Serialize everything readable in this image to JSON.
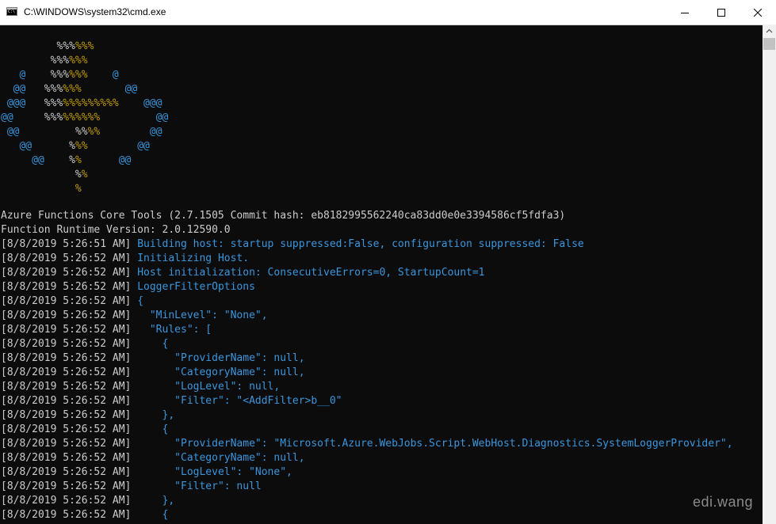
{
  "window": {
    "title": "C:\\WINDOWS\\system32\\cmd.exe",
    "icon": "cmd-icon",
    "buttons": [
      "minimize-icon",
      "maximize-icon",
      "close-icon"
    ]
  },
  "colors": {
    "background": "#0c0c0c",
    "text": "#cccccc",
    "cyan": "#3a96dd",
    "yellow": "#c19c00"
  },
  "logo": [
    [
      [
        "         ",
        "w"
      ],
      [
        "%%%",
        "wy"
      ],
      [
        "%%%",
        "y"
      ]
    ],
    [
      [
        "        ",
        "w"
      ],
      [
        "%%%",
        "wy"
      ],
      [
        "%%%",
        "y"
      ]
    ],
    [
      [
        "   ",
        "w"
      ],
      [
        "@",
        "c"
      ],
      [
        "    ",
        "w"
      ],
      [
        "%%%",
        "wy"
      ],
      [
        "%%%",
        "y"
      ],
      [
        "    ",
        "w"
      ],
      [
        "@",
        "c"
      ]
    ],
    [
      [
        "  ",
        "w"
      ],
      [
        "@@",
        "c"
      ],
      [
        "   ",
        "w"
      ],
      [
        "%%%",
        "wy"
      ],
      [
        "%%%",
        "y"
      ],
      [
        "       ",
        "w"
      ],
      [
        "@@",
        "c"
      ]
    ],
    [
      [
        " ",
        "w"
      ],
      [
        "@@@",
        "c"
      ],
      [
        "   ",
        "w"
      ],
      [
        "%%%",
        "wy"
      ],
      [
        "%%%%%%%%%",
        "y"
      ],
      [
        "    ",
        "w"
      ],
      [
        "@@@",
        "c"
      ]
    ],
    [
      [
        "",
        "w"
      ],
      [
        "@@",
        "c"
      ],
      [
        "     ",
        "w"
      ],
      [
        "%%%",
        "wy"
      ],
      [
        "%%%%%%",
        "y"
      ],
      [
        "         ",
        "w"
      ],
      [
        "@@",
        "c"
      ]
    ],
    [
      [
        " ",
        "w"
      ],
      [
        "@@",
        "c"
      ],
      [
        "         ",
        "w"
      ],
      [
        "%%",
        "wy"
      ],
      [
        "%%",
        "y"
      ],
      [
        "        ",
        "w"
      ],
      [
        "@@",
        "c"
      ]
    ],
    [
      [
        "   ",
        "w"
      ],
      [
        "@@",
        "c"
      ],
      [
        "      ",
        "w"
      ],
      [
        "%",
        "wy"
      ],
      [
        "%%",
        "y"
      ],
      [
        "        ",
        "w"
      ],
      [
        "@@",
        "c"
      ]
    ],
    [
      [
        "     ",
        "w"
      ],
      [
        "@@",
        "c"
      ],
      [
        "    ",
        "w"
      ],
      [
        "%",
        "wy"
      ],
      [
        "%",
        "y"
      ],
      [
        "      ",
        "w"
      ],
      [
        "@@",
        "c"
      ]
    ],
    [
      [
        "            ",
        "w"
      ],
      [
        "%",
        "wy"
      ],
      [
        "%",
        "y"
      ]
    ],
    [
      [
        "            ",
        "w"
      ],
      [
        "%",
        "y"
      ]
    ]
  ],
  "header_lines": [
    "Azure Functions Core Tools (2.7.1505 Commit hash: eb8182995562240ca83dd0e0e3394586cf5fdfa3)",
    "Function Runtime Version: 2.0.12590.0"
  ],
  "log_lines": [
    {
      "ts": "[8/8/2019 5:26:51 AM]",
      "msg": " Building host: startup suppressed:False, configuration suppressed: False"
    },
    {
      "ts": "[8/8/2019 5:26:52 AM]",
      "msg": " Initializing Host."
    },
    {
      "ts": "[8/8/2019 5:26:52 AM]",
      "msg": " Host initialization: ConsecutiveErrors=0, StartupCount=1"
    },
    {
      "ts": "[8/8/2019 5:26:52 AM]",
      "msg": " LoggerFilterOptions"
    },
    {
      "ts": "[8/8/2019 5:26:52 AM]",
      "msg": " {"
    },
    {
      "ts": "[8/8/2019 5:26:52 AM]",
      "msg": "   \"MinLevel\": \"None\","
    },
    {
      "ts": "[8/8/2019 5:26:52 AM]",
      "msg": "   \"Rules\": ["
    },
    {
      "ts": "[8/8/2019 5:26:52 AM]",
      "msg": "     {"
    },
    {
      "ts": "[8/8/2019 5:26:52 AM]",
      "msg": "       \"ProviderName\": null,"
    },
    {
      "ts": "[8/8/2019 5:26:52 AM]",
      "msg": "       \"CategoryName\": null,"
    },
    {
      "ts": "[8/8/2019 5:26:52 AM]",
      "msg": "       \"LogLevel\": null,"
    },
    {
      "ts": "[8/8/2019 5:26:52 AM]",
      "msg": "       \"Filter\": \"<AddFilter>b__0\""
    },
    {
      "ts": "[8/8/2019 5:26:52 AM]",
      "msg": "     },"
    },
    {
      "ts": "[8/8/2019 5:26:52 AM]",
      "msg": "     {"
    },
    {
      "ts": "[8/8/2019 5:26:52 AM]",
      "msg": "       \"ProviderName\": \"Microsoft.Azure.WebJobs.Script.WebHost.Diagnostics.SystemLoggerProvider\","
    },
    {
      "ts": "[8/8/2019 5:26:52 AM]",
      "msg": "       \"CategoryName\": null,"
    },
    {
      "ts": "[8/8/2019 5:26:52 AM]",
      "msg": "       \"LogLevel\": \"None\","
    },
    {
      "ts": "[8/8/2019 5:26:52 AM]",
      "msg": "       \"Filter\": null"
    },
    {
      "ts": "[8/8/2019 5:26:52 AM]",
      "msg": "     },"
    },
    {
      "ts": "[8/8/2019 5:26:52 AM]",
      "msg": "     {"
    }
  ],
  "watermark": "edi.wang"
}
